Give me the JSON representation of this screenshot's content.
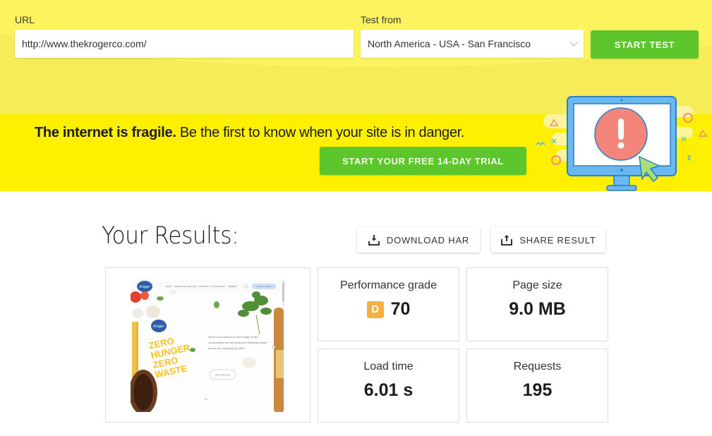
{
  "form": {
    "url_label": "URL",
    "url_value": "http://www.thekrogerco.com/",
    "test_from_label": "Test from",
    "test_from_selected": "North America - USA - San Francisco",
    "start_test_label": "START TEST"
  },
  "promo": {
    "headline_bold": "The internet is fragile.",
    "headline_rest": " Be the first to know when your site is in danger.",
    "trial_button_label": "START YOUR FREE 14-DAY TRIAL",
    "illustration": "monitor-alert-icon"
  },
  "results": {
    "title": "Your Results:",
    "download_har_label": "DOWNLOAD HAR",
    "share_result_label": "SHARE RESULT",
    "thumbnail": {
      "nav_items": [
        "ABOUT",
        "NEWSROOM",
        "INVESTORS",
        "COMMUNITY",
        "SUSTAINABILITY",
        "CAREERS"
      ],
      "nav_button": "Join Our Journey",
      "hero_lines": [
        "ZERO",
        "HUNGER",
        "ZERO",
        "WASTE"
      ],
      "body_text": "We're on a mission to end hunger in the communities we call home and eliminate waste across our company by 2025.",
      "cta": "SEE OUR PLAN"
    },
    "metrics": [
      {
        "label": "Performance grade",
        "grade": "D",
        "value": "70",
        "grade_color": "#f5b041"
      },
      {
        "label": "Page size",
        "value": "9.0 MB"
      },
      {
        "label": "Load time",
        "value": "6.01 s"
      },
      {
        "label": "Requests",
        "value": "195"
      }
    ]
  },
  "colors": {
    "top_bg": "#f6ec58",
    "band_bg": "#fff000",
    "accent_green": "#5dc62c"
  }
}
